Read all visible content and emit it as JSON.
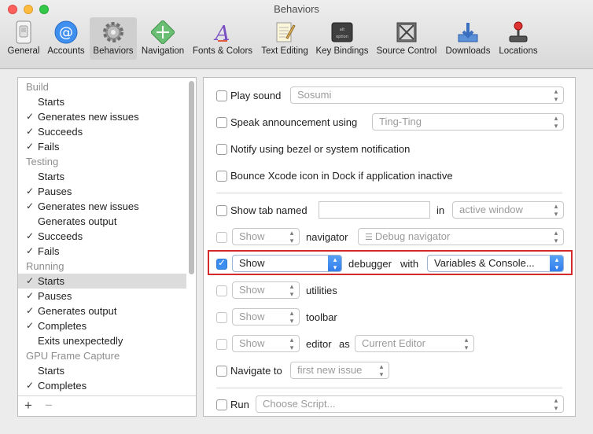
{
  "window": {
    "title": "Behaviors"
  },
  "toolbar": {
    "items": [
      {
        "label": "General"
      },
      {
        "label": "Accounts"
      },
      {
        "label": "Behaviors"
      },
      {
        "label": "Navigation"
      },
      {
        "label": "Fonts & Colors"
      },
      {
        "label": "Text Editing"
      },
      {
        "label": "Key Bindings"
      },
      {
        "label": "Source Control"
      },
      {
        "label": "Downloads"
      },
      {
        "label": "Locations"
      }
    ],
    "selected": "Behaviors"
  },
  "tree": {
    "rows": [
      {
        "type": "category",
        "label": "Build"
      },
      {
        "type": "item",
        "label": "Starts",
        "checked": false
      },
      {
        "type": "item",
        "label": "Generates new issues",
        "checked": true
      },
      {
        "type": "item",
        "label": "Succeeds",
        "checked": true
      },
      {
        "type": "item",
        "label": "Fails",
        "checked": true
      },
      {
        "type": "category",
        "label": "Testing"
      },
      {
        "type": "item",
        "label": "Starts",
        "checked": false
      },
      {
        "type": "item",
        "label": "Pauses",
        "checked": true
      },
      {
        "type": "item",
        "label": "Generates new issues",
        "checked": true
      },
      {
        "type": "item",
        "label": "Generates output",
        "checked": false
      },
      {
        "type": "item",
        "label": "Succeeds",
        "checked": true
      },
      {
        "type": "item",
        "label": "Fails",
        "checked": true
      },
      {
        "type": "category",
        "label": "Running"
      },
      {
        "type": "item",
        "label": "Starts",
        "checked": true,
        "selected": true
      },
      {
        "type": "item",
        "label": "Pauses",
        "checked": true
      },
      {
        "type": "item",
        "label": "Generates output",
        "checked": true
      },
      {
        "type": "item",
        "label": "Completes",
        "checked": true
      },
      {
        "type": "item",
        "label": "Exits unexpectedly",
        "checked": false
      },
      {
        "type": "category",
        "label": "GPU Frame Capture"
      },
      {
        "type": "item",
        "label": "Starts",
        "checked": false
      },
      {
        "type": "item",
        "label": "Completes",
        "checked": true
      }
    ],
    "add_label": "+",
    "remove_label": "−"
  },
  "behaviors": {
    "play_sound": {
      "label": "Play sound",
      "value": "Sosumi"
    },
    "speak": {
      "label": "Speak announcement using",
      "value": "Ting-Ting"
    },
    "notify": {
      "label": "Notify using bezel or system notification"
    },
    "bounce": {
      "label": "Bounce Xcode icon in Dock if application inactive"
    },
    "show_tab": {
      "label": "Show tab named",
      "value": "",
      "in_label": "in",
      "window_value": "active window"
    },
    "navigator": {
      "show_value": "Show",
      "label": "navigator",
      "value": "Debug navigator"
    },
    "debugger": {
      "show_value": "Show",
      "label": "debugger",
      "with_label": "with",
      "value": "Variables & Console..."
    },
    "utilities": {
      "show_value": "Show",
      "label": "utilities"
    },
    "toolbar_row": {
      "show_value": "Show",
      "label": "toolbar"
    },
    "editor": {
      "show_value": "Show",
      "label": "editor",
      "as_label": "as",
      "value": "Current Editor"
    },
    "navigate": {
      "label": "Navigate to",
      "value": "first new issue"
    },
    "run": {
      "label": "Run",
      "value": "Choose Script..."
    }
  },
  "colors": {
    "highlight": "#d32a2a",
    "accent": "#3b8ef0"
  }
}
